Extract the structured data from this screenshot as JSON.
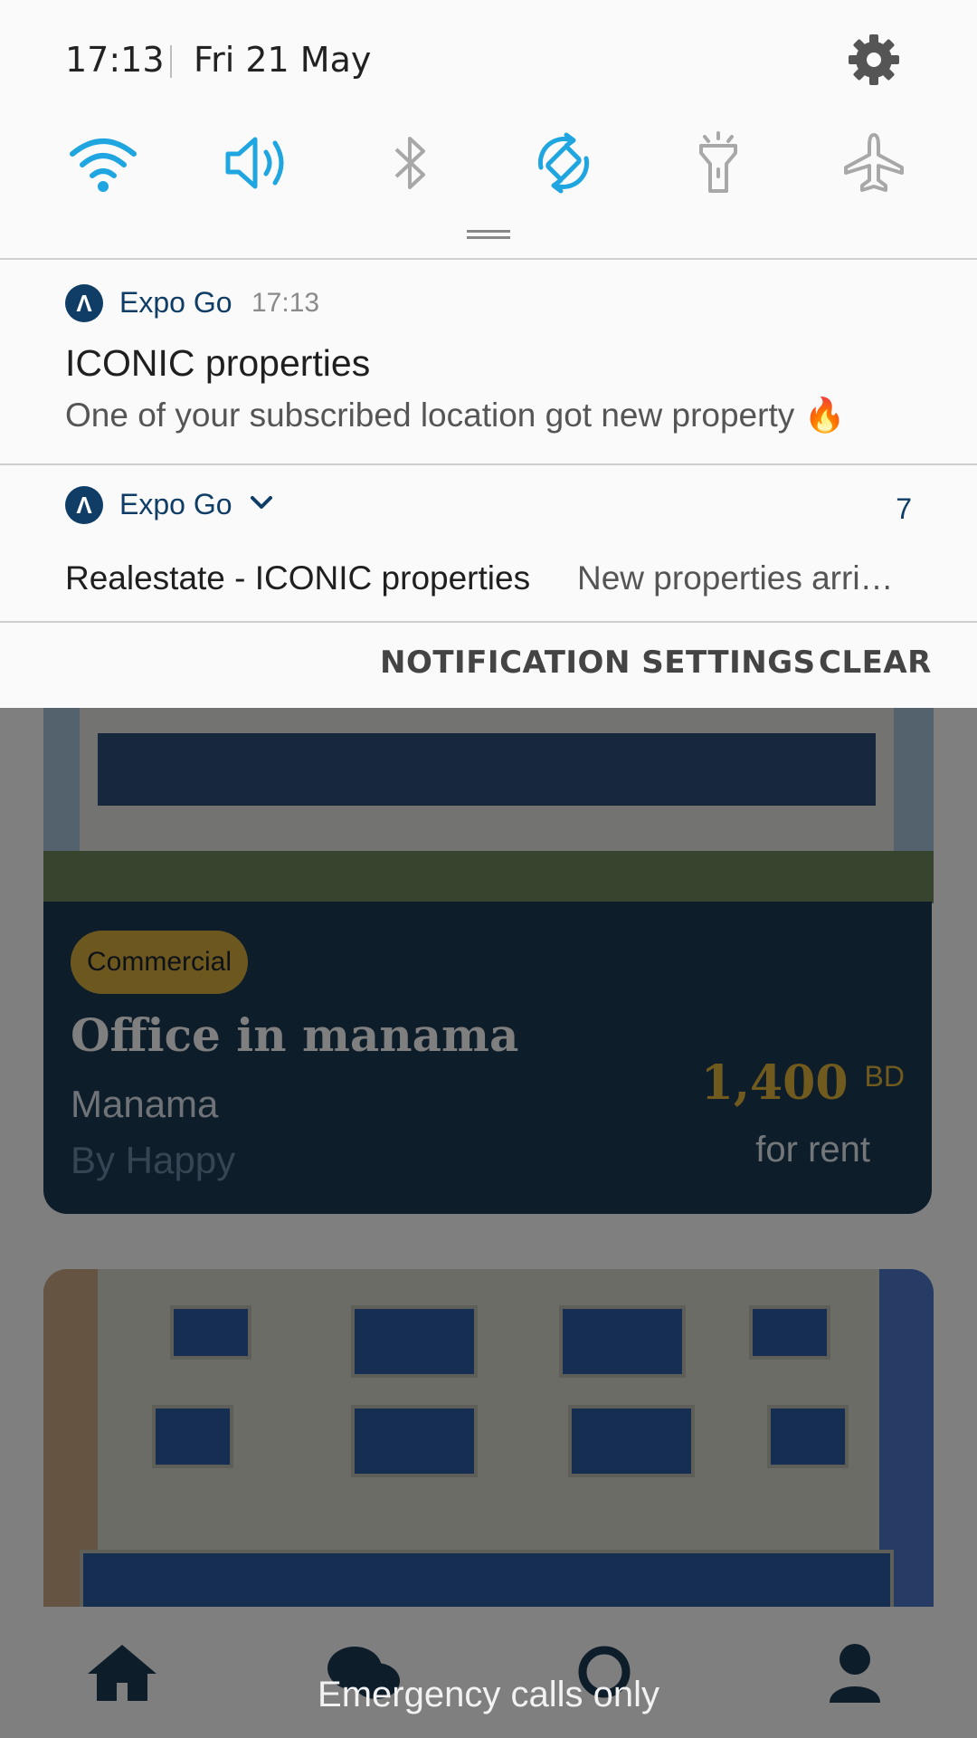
{
  "status": {
    "time": "17:13",
    "date": "Fri 21 May"
  },
  "quick_settings": [
    {
      "icon": "wifi-icon",
      "active": true
    },
    {
      "icon": "sound-icon",
      "active": true
    },
    {
      "icon": "bluetooth-icon",
      "active": false
    },
    {
      "icon": "auto-rotate-icon",
      "active": true
    },
    {
      "icon": "flashlight-icon",
      "active": false
    },
    {
      "icon": "airplane-mode-icon",
      "active": false
    }
  ],
  "notifications": [
    {
      "app": "Expo Go",
      "time": "17:13",
      "title": "ICONIC properties",
      "text": "One of your subscribed location got new property 🔥"
    },
    {
      "app": "Expo Go",
      "count": "7",
      "title": "Realestate - ICONIC properties",
      "text": "New properties arri…"
    }
  ],
  "actions": {
    "settings": "NOTIFICATION SETTINGS",
    "clear": "CLEAR"
  },
  "listing": {
    "tag": "Commercial",
    "title": "Office in manama",
    "location": "Manama",
    "by": "By Happy",
    "price": "1,400",
    "currency": "BD",
    "mode": "for rent"
  },
  "tabs": [
    "home-icon",
    "chat-icon",
    "search-icon",
    "profile-icon"
  ],
  "footer": {
    "emergency": "Emergency calls only"
  },
  "colors": {
    "accent": "#1fa5e0",
    "brand": "#0f3d66",
    "gold": "#e0b43c",
    "card": "#1c3a55"
  }
}
